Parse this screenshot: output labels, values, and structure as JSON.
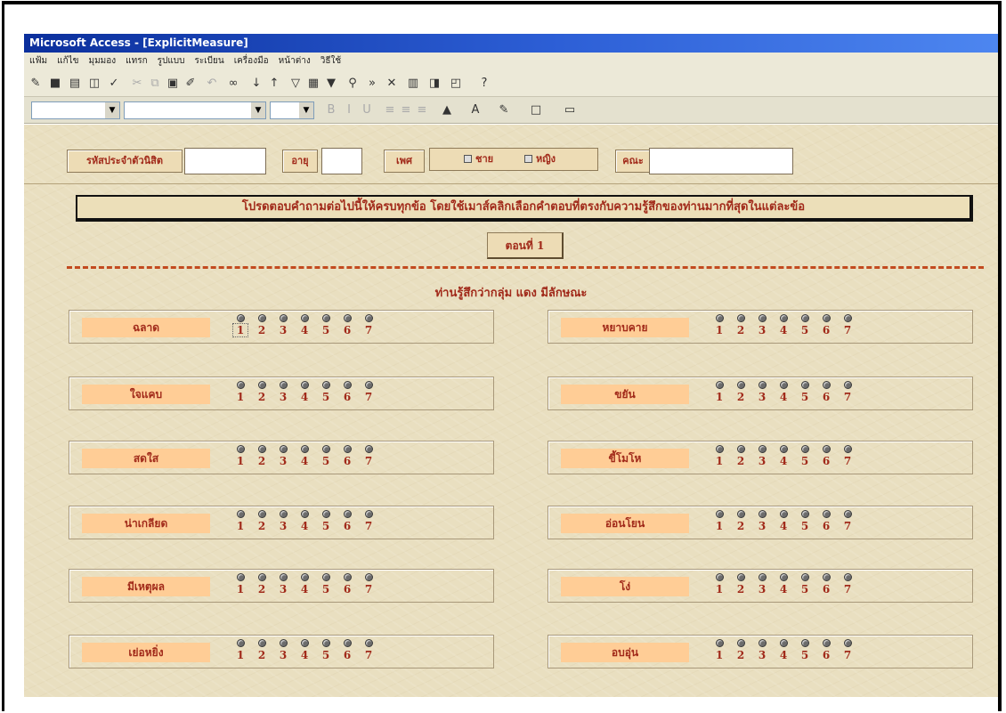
{
  "window": {
    "title": "Microsoft Access - [ExplicitMeasure]"
  },
  "menu": [
    "แฟ้ม",
    "แก้ไข",
    "มุมมอง",
    "แทรก",
    "รูปแบบ",
    "ระเบียน",
    "เครื่องมือ",
    "หน้าต่าง",
    "วิธีใช้"
  ],
  "toolbar": {
    "row1": [
      "design-view-icon",
      "save-icon",
      "print-icon",
      "print-preview-icon",
      "spelling-icon",
      "cut-icon",
      "copy-icon",
      "paste-icon",
      "format-painter-icon",
      "undo-icon",
      "hyperlink-icon",
      "sort-ascending-icon",
      "sort-descending-icon",
      "filter-by-selection-icon",
      "filter-by-form-icon",
      "apply-filter-icon",
      "find-icon",
      "new-record-icon",
      "delete-record-icon",
      "properties-icon",
      "database-window-icon",
      "new-object-icon",
      "help-icon"
    ],
    "row2": [
      "object-combo",
      "font-name-combo",
      "font-size-combo",
      "bold-icon",
      "italic-icon",
      "underline-icon",
      "align-left-icon",
      "align-center-icon",
      "align-right-icon",
      "fill-color-icon",
      "font-color-icon",
      "line-color-icon",
      "border-icon",
      "special-effect-icon"
    ]
  },
  "form": {
    "student_id_label": "รหัสประจำตัวนิสิต",
    "student_id_value": "",
    "age_label": "อายุ",
    "age_value": "",
    "gender_label": "เพศ",
    "gender_male": "ชาย",
    "gender_female": "หญิง",
    "faculty_label": "คณะ",
    "faculty_value": "",
    "instruction": "โปรดตอบคำถามต่อไปนี้ให้ครบทุกข้อ โดยใช้เมาส์คลิกเลือกคำตอบที่ตรงกับความรู้สึกของท่านมากที่สุดในแต่ละข้อ",
    "section_button": "ตอนที่ 1",
    "prompt": "ท่านรู้สึกว่ากลุ่ม แดง มีลักษณะ"
  },
  "scale": [
    "1",
    "2",
    "3",
    "4",
    "5",
    "6",
    "7"
  ],
  "items_left": [
    "ฉลาด",
    "ใจแคบ",
    "สดใส",
    "น่าเกลียด",
    "มีเหตุผล",
    "เย่อหยิ่ง"
  ],
  "items_right": [
    "หยาบคาย",
    "ขยัน",
    "ขี้โมโห",
    "อ่อนโยน",
    "โง่",
    "อบอุ่น"
  ]
}
